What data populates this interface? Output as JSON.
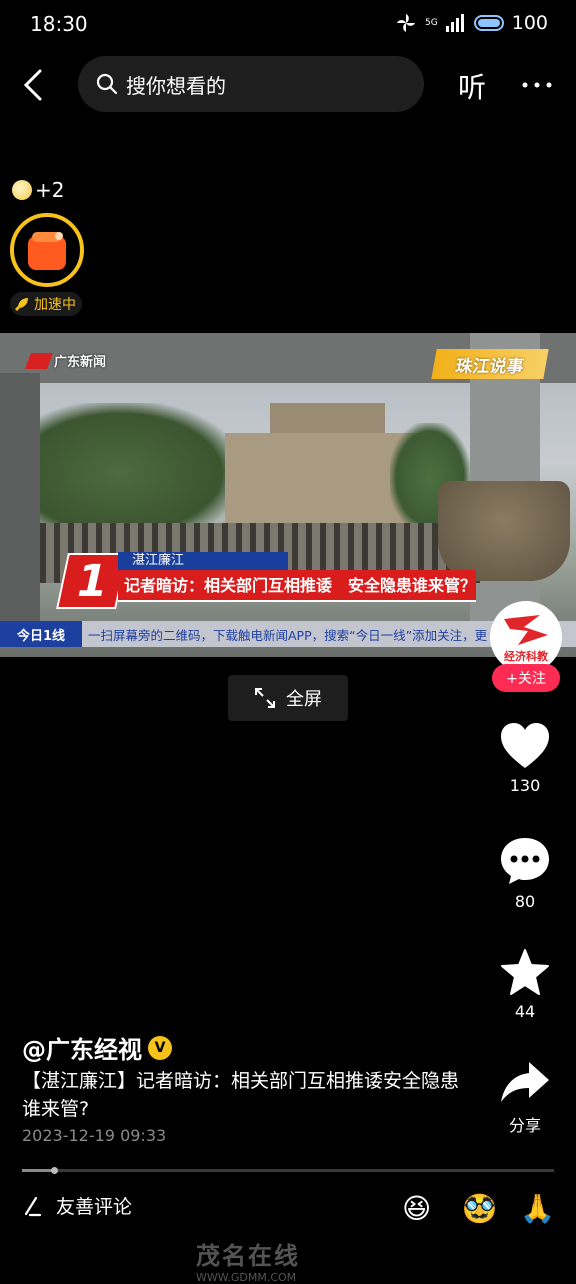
{
  "status_bar": {
    "time": "18:30",
    "network": "5G",
    "battery": "100"
  },
  "top_bar": {
    "search_placeholder": "搜你想看的",
    "listen_label": "听"
  },
  "reward": {
    "coin_text": "+2",
    "speed_label": "加速中"
  },
  "video": {
    "source_logo": "广东新闻",
    "channel_badge": "珠江说事",
    "segment_number": "1",
    "location": "湛江廉江",
    "headline": "记者暗访：相关部门互相推诿　安全隐患谁来管？",
    "ticker_logo": "今日1线",
    "ticker_text": "一扫屏幕旁的二维码，下载触电新闻APP，搜索“今日一线”添加关注，更"
  },
  "fullscreen_label": "全屏",
  "sidebar": {
    "creator_logo_text": "经济科教",
    "follow_label": "+关注",
    "like_count": "130",
    "comment_count": "80",
    "favorite_count": "44",
    "share_label": "分享"
  },
  "post": {
    "author": "@广东经视",
    "caption": "【湛江廉江】记者暗访：相关部门互相推诿安全隐患谁来管?",
    "date": "2023-12-19 09:33",
    "progress_fraction": 0.06
  },
  "bottom_bar": {
    "comment_placeholder": "友善评论",
    "emojis": [
      "😆",
      "🥸",
      "🙏"
    ]
  },
  "watermark": {
    "main": "茂名在线",
    "sub": "WWW.GDMM.COM"
  },
  "colors": {
    "accent_red": "#fe2c55",
    "reward_gold": "#f7c21b"
  }
}
